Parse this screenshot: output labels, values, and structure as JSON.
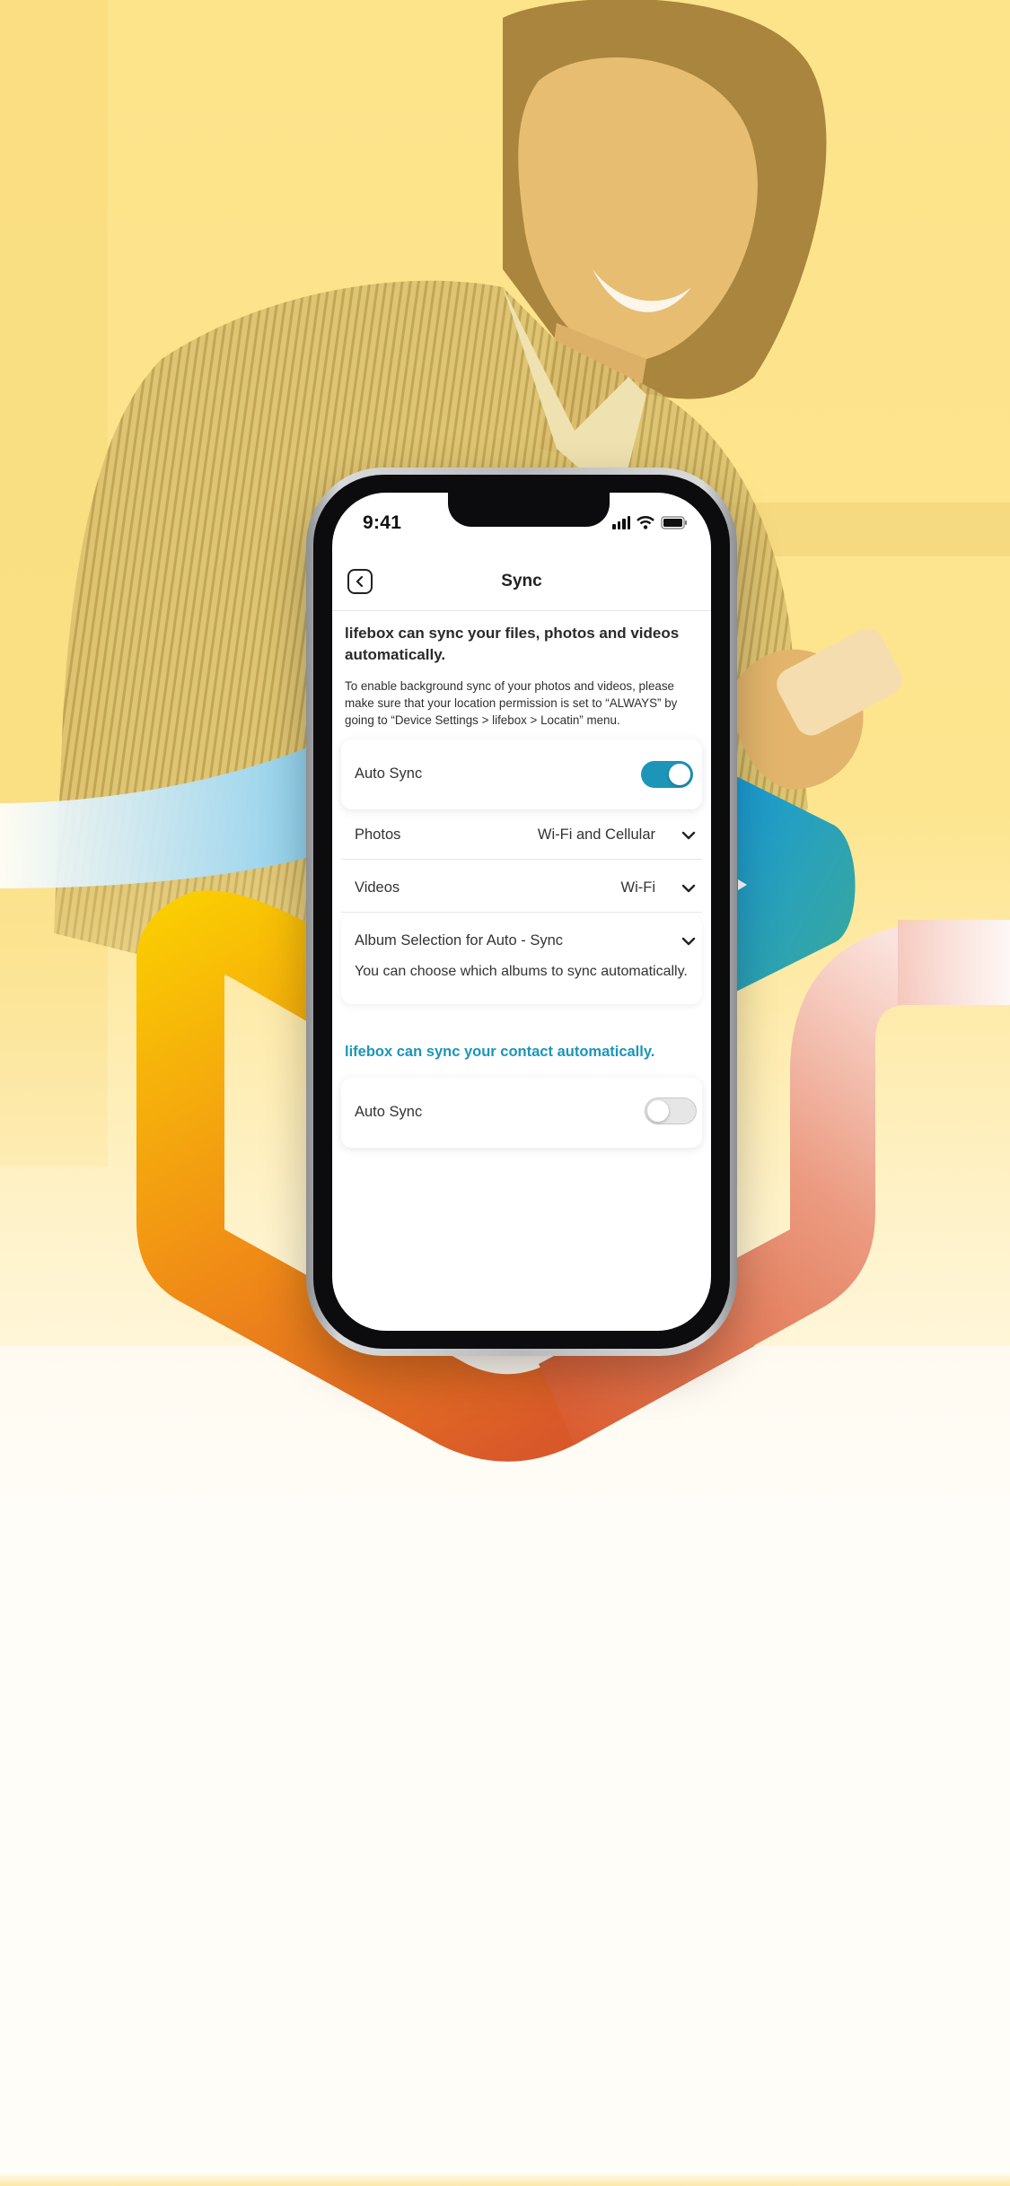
{
  "status": {
    "time": "9:41"
  },
  "nav": {
    "title": "Sync"
  },
  "intro": {
    "title": "lifebox can sync your files, photos and videos automatically.",
    "description": "To enable background sync of your photos and videos, please make sure that your location permission is set to “ALWAYS” by going to “Device Settings > lifebox > Locatin” menu."
  },
  "media_sync": {
    "auto_sync_label": "Auto Sync",
    "auto_sync_on": true,
    "photos_label": "Photos",
    "photos_value": "Wi-Fi and Cellular",
    "videos_label": "Videos",
    "videos_value": "Wi-Fi",
    "album_label": "Album Selection for Auto - Sync",
    "album_desc": "You can choose which albums to sync automatically."
  },
  "contact_sync": {
    "title": "lifebox can sync your contact automatically.",
    "auto_sync_label": "Auto Sync",
    "auto_sync_on": false
  },
  "colors": {
    "accent": "#1c95b8",
    "background_yellow": "#fde38a",
    "ribbon_yellow": "#f7c800",
    "ribbon_orange": "#de5a2a",
    "ribbon_pink": "#f2b6a8"
  },
  "icons": [
    "back-icon",
    "chevron-down-icon",
    "signal-icon",
    "wifi-icon",
    "battery-icon"
  ]
}
